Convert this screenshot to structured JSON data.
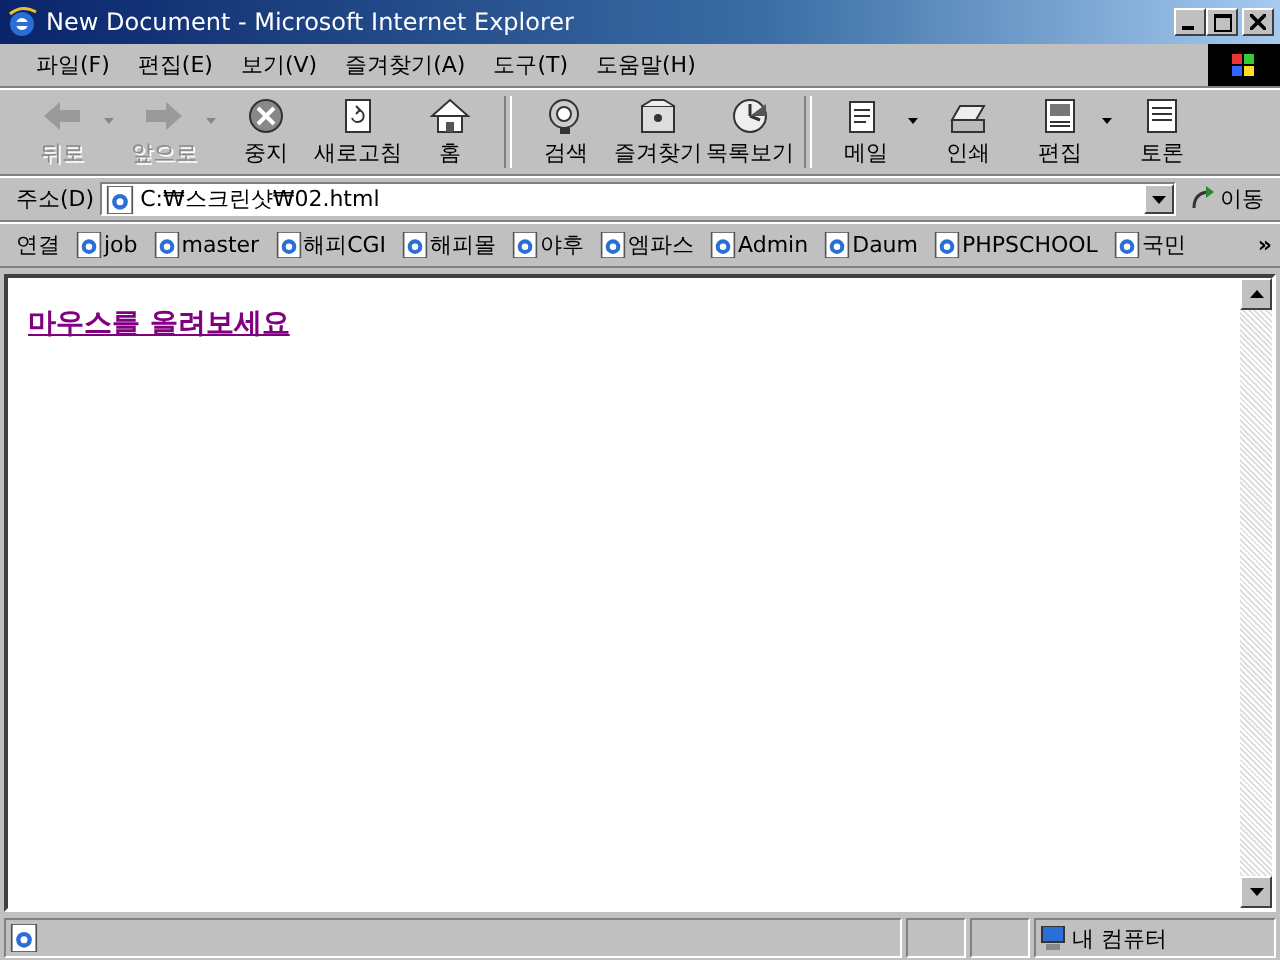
{
  "window": {
    "title": "New Document - Microsoft Internet Explorer"
  },
  "menu": [
    "파일(F)",
    "편집(E)",
    "보기(V)",
    "즐겨찾기(A)",
    "도구(T)",
    "도움말(H)"
  ],
  "toolbar": [
    {
      "kind": "back",
      "label": "뒤로",
      "disabled": true,
      "dropdown": true
    },
    {
      "kind": "forward",
      "label": "앞으로",
      "disabled": true,
      "dropdown": true
    },
    {
      "kind": "stop",
      "label": "중지",
      "disabled": false,
      "dropdown": false
    },
    {
      "kind": "refresh",
      "label": "새로고침",
      "disabled": false,
      "dropdown": false
    },
    {
      "kind": "home",
      "label": "홈",
      "disabled": false,
      "dropdown": false
    },
    {
      "kind": "separator"
    },
    {
      "kind": "search",
      "label": "검색",
      "disabled": false,
      "dropdown": false
    },
    {
      "kind": "favorites",
      "label": "즐겨찾기",
      "disabled": false,
      "dropdown": false
    },
    {
      "kind": "history",
      "label": "목록보기",
      "disabled": false,
      "dropdown": false
    },
    {
      "kind": "separator"
    },
    {
      "kind": "mail",
      "label": "메일",
      "disabled": false,
      "dropdown": true
    },
    {
      "kind": "print",
      "label": "인쇄",
      "disabled": false,
      "dropdown": false
    },
    {
      "kind": "edit",
      "label": "편집",
      "disabled": false,
      "dropdown": true
    },
    {
      "kind": "discuss",
      "label": "토론",
      "disabled": false,
      "dropdown": false
    }
  ],
  "address": {
    "label": "주소(D)",
    "value": "C:₩스크린샷₩02.html",
    "go": "이동"
  },
  "links": {
    "label": "연결",
    "items": [
      "job",
      "master",
      "해피CGI",
      "해피몰",
      "야후",
      "엠파스",
      "Admin",
      "Daum",
      "PHPSCHOOL",
      "국민"
    ],
    "more": "»"
  },
  "content": {
    "link": "마우스를 올려보세요"
  },
  "status_bar": {
    "zone": "내 컴퓨터"
  }
}
